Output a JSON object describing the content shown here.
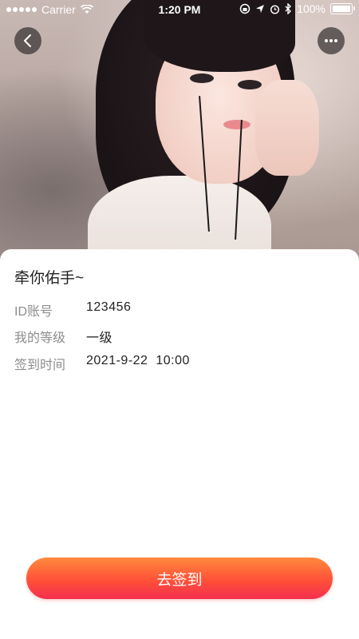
{
  "status_bar": {
    "carrier": "Carrier",
    "time": "1:20 PM",
    "battery": "100%"
  },
  "header": {
    "back_icon": "chevron-left-icon",
    "more_icon": "more-dots-icon"
  },
  "profile": {
    "name": "牵你佑手~",
    "fields": [
      {
        "label": "ID账号",
        "value": "123456"
      },
      {
        "label": "我的等级",
        "value": "一级"
      },
      {
        "label": "签到时间",
        "value": "2021-9-22  10:00"
      }
    ]
  },
  "actions": {
    "checkin_label": "去签到"
  },
  "colors": {
    "button_gradient_start": "#ff8a3d",
    "button_gradient_end": "#f42f4f",
    "label_gray": "#8d8d8d"
  }
}
